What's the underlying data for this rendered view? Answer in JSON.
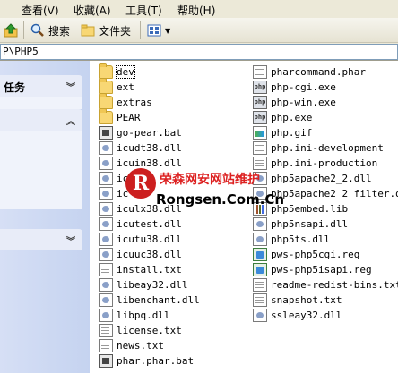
{
  "menu": {
    "view": "查看(V)",
    "favorites": "收藏(A)",
    "tools": "工具(T)",
    "help": "帮助(H)"
  },
  "toolbar": {
    "search_label": "搜索",
    "folders_label": "文件夹"
  },
  "address": {
    "path": "P\\PHP5"
  },
  "taskpane": {
    "section1_title": "任务"
  },
  "files": {
    "col1": [
      {
        "name": "dev",
        "icon": "folder-icon"
      },
      {
        "name": "ext",
        "icon": "folder-icon"
      },
      {
        "name": "extras",
        "icon": "folder-icon"
      },
      {
        "name": "PEAR",
        "icon": "folder-icon"
      },
      {
        "name": "go-pear.bat",
        "icon": "batch-file-icon"
      },
      {
        "name": "icudt38.dll",
        "icon": "dll-file-icon"
      },
      {
        "name": "icuin38.dll",
        "icon": "dll-file-icon"
      },
      {
        "name": "ic",
        "icon": "dll-file-icon"
      },
      {
        "name": "ic",
        "icon": "dll-file-icon"
      },
      {
        "name": "iculx38.dll",
        "icon": "dll-file-icon"
      },
      {
        "name": "icutest.dll",
        "icon": "dll-file-icon"
      },
      {
        "name": "icutu38.dll",
        "icon": "dll-file-icon"
      },
      {
        "name": "icuuc38.dll",
        "icon": "dll-file-icon"
      },
      {
        "name": "install.txt",
        "icon": "text-file-icon"
      },
      {
        "name": "libeay32.dll",
        "icon": "dll-file-icon"
      },
      {
        "name": "libenchant.dll",
        "icon": "dll-file-icon"
      },
      {
        "name": "libpq.dll",
        "icon": "dll-file-icon"
      },
      {
        "name": "license.txt",
        "icon": "text-file-icon"
      },
      {
        "name": "news.txt",
        "icon": "text-file-icon"
      },
      {
        "name": "phar.phar.bat",
        "icon": "batch-file-icon"
      }
    ],
    "col2": [
      {
        "name": "pharcommand.phar",
        "icon": "phar-file-icon"
      },
      {
        "name": "php-cgi.exe",
        "icon": "exe-file-icon"
      },
      {
        "name": "php-win.exe",
        "icon": "exe-file-icon"
      },
      {
        "name": "php.exe",
        "icon": "exe-file-icon"
      },
      {
        "name": "php.gif",
        "icon": "image-file-icon"
      },
      {
        "name": "php.ini-development",
        "icon": "ini-file-icon"
      },
      {
        "name": "php.ini-production",
        "icon": "ini-file-icon"
      },
      {
        "name": "php5apache2_2.dll",
        "icon": "dll-file-icon"
      },
      {
        "name": "php5apache2_2_filter.dll",
        "icon": "dll-file-icon"
      },
      {
        "name": "php5embed.lib",
        "icon": "lib-file-icon"
      },
      {
        "name": "php5nsapi.dll",
        "icon": "dll-file-icon"
      },
      {
        "name": "php5ts.dll",
        "icon": "dll-file-icon"
      },
      {
        "name": "pws-php5cgi.reg",
        "icon": "registry-file-icon"
      },
      {
        "name": "pws-php5isapi.reg",
        "icon": "registry-file-icon"
      },
      {
        "name": "readme-redist-bins.txt",
        "icon": "text-file-icon"
      },
      {
        "name": "snapshot.txt",
        "icon": "text-file-icon"
      },
      {
        "name": "ssleay32.dll",
        "icon": "dll-file-icon"
      }
    ]
  },
  "watermark": {
    "logo_letter": "R",
    "cn_text": "荣森网安网站维护",
    "en_text": "Rongsen.Com.Cn"
  }
}
